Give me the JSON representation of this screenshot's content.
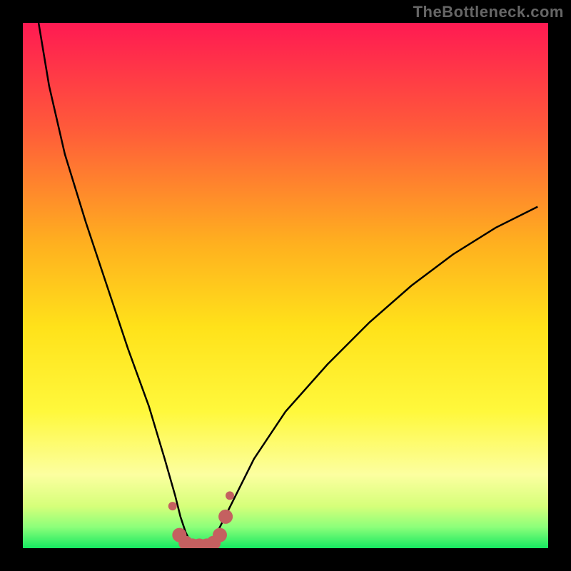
{
  "watermark": "TheBottleneck.com",
  "chart_data": {
    "type": "line",
    "title": "",
    "xlabel": "",
    "ylabel": "",
    "xlim": [
      0,
      100
    ],
    "ylim": [
      0,
      100
    ],
    "grid": false,
    "legend": false,
    "series": [
      {
        "name": "bottleneck-curve",
        "x": [
          3,
          5,
          8,
          12,
          16,
          20,
          24,
          27,
          29,
          30,
          31,
          32,
          33,
          34,
          35,
          36,
          37,
          38,
          40,
          44,
          50,
          58,
          66,
          74,
          82,
          90,
          98
        ],
        "values": [
          100,
          88,
          75,
          62,
          50,
          38,
          27,
          17,
          10,
          6,
          3,
          1,
          0,
          0,
          0,
          1,
          3,
          5,
          9,
          17,
          26,
          35,
          43,
          50,
          56,
          61,
          65
        ]
      }
    ],
    "markers": {
      "name": "highlight-dots",
      "color": "#c46060",
      "points_x": [
        28.5,
        29.8,
        31,
        32.3,
        33.6,
        35,
        36.3,
        37.5,
        38.6,
        39.4
      ],
      "points_y": [
        8,
        2.5,
        1,
        0.5,
        0.5,
        0.5,
        1,
        2.5,
        6,
        10
      ],
      "points_r": [
        6,
        10,
        10,
        10,
        10,
        10,
        10,
        10,
        10,
        6
      ]
    },
    "gradient_stops": [
      {
        "offset": 0.0,
        "color": "#ff1a52"
      },
      {
        "offset": 0.2,
        "color": "#ff5a3a"
      },
      {
        "offset": 0.42,
        "color": "#ffb01f"
      },
      {
        "offset": 0.58,
        "color": "#ffe21a"
      },
      {
        "offset": 0.74,
        "color": "#fff83c"
      },
      {
        "offset": 0.86,
        "color": "#fcffa0"
      },
      {
        "offset": 0.92,
        "color": "#d6ff7a"
      },
      {
        "offset": 0.96,
        "color": "#8cff7a"
      },
      {
        "offset": 1.0,
        "color": "#16e861"
      }
    ]
  }
}
